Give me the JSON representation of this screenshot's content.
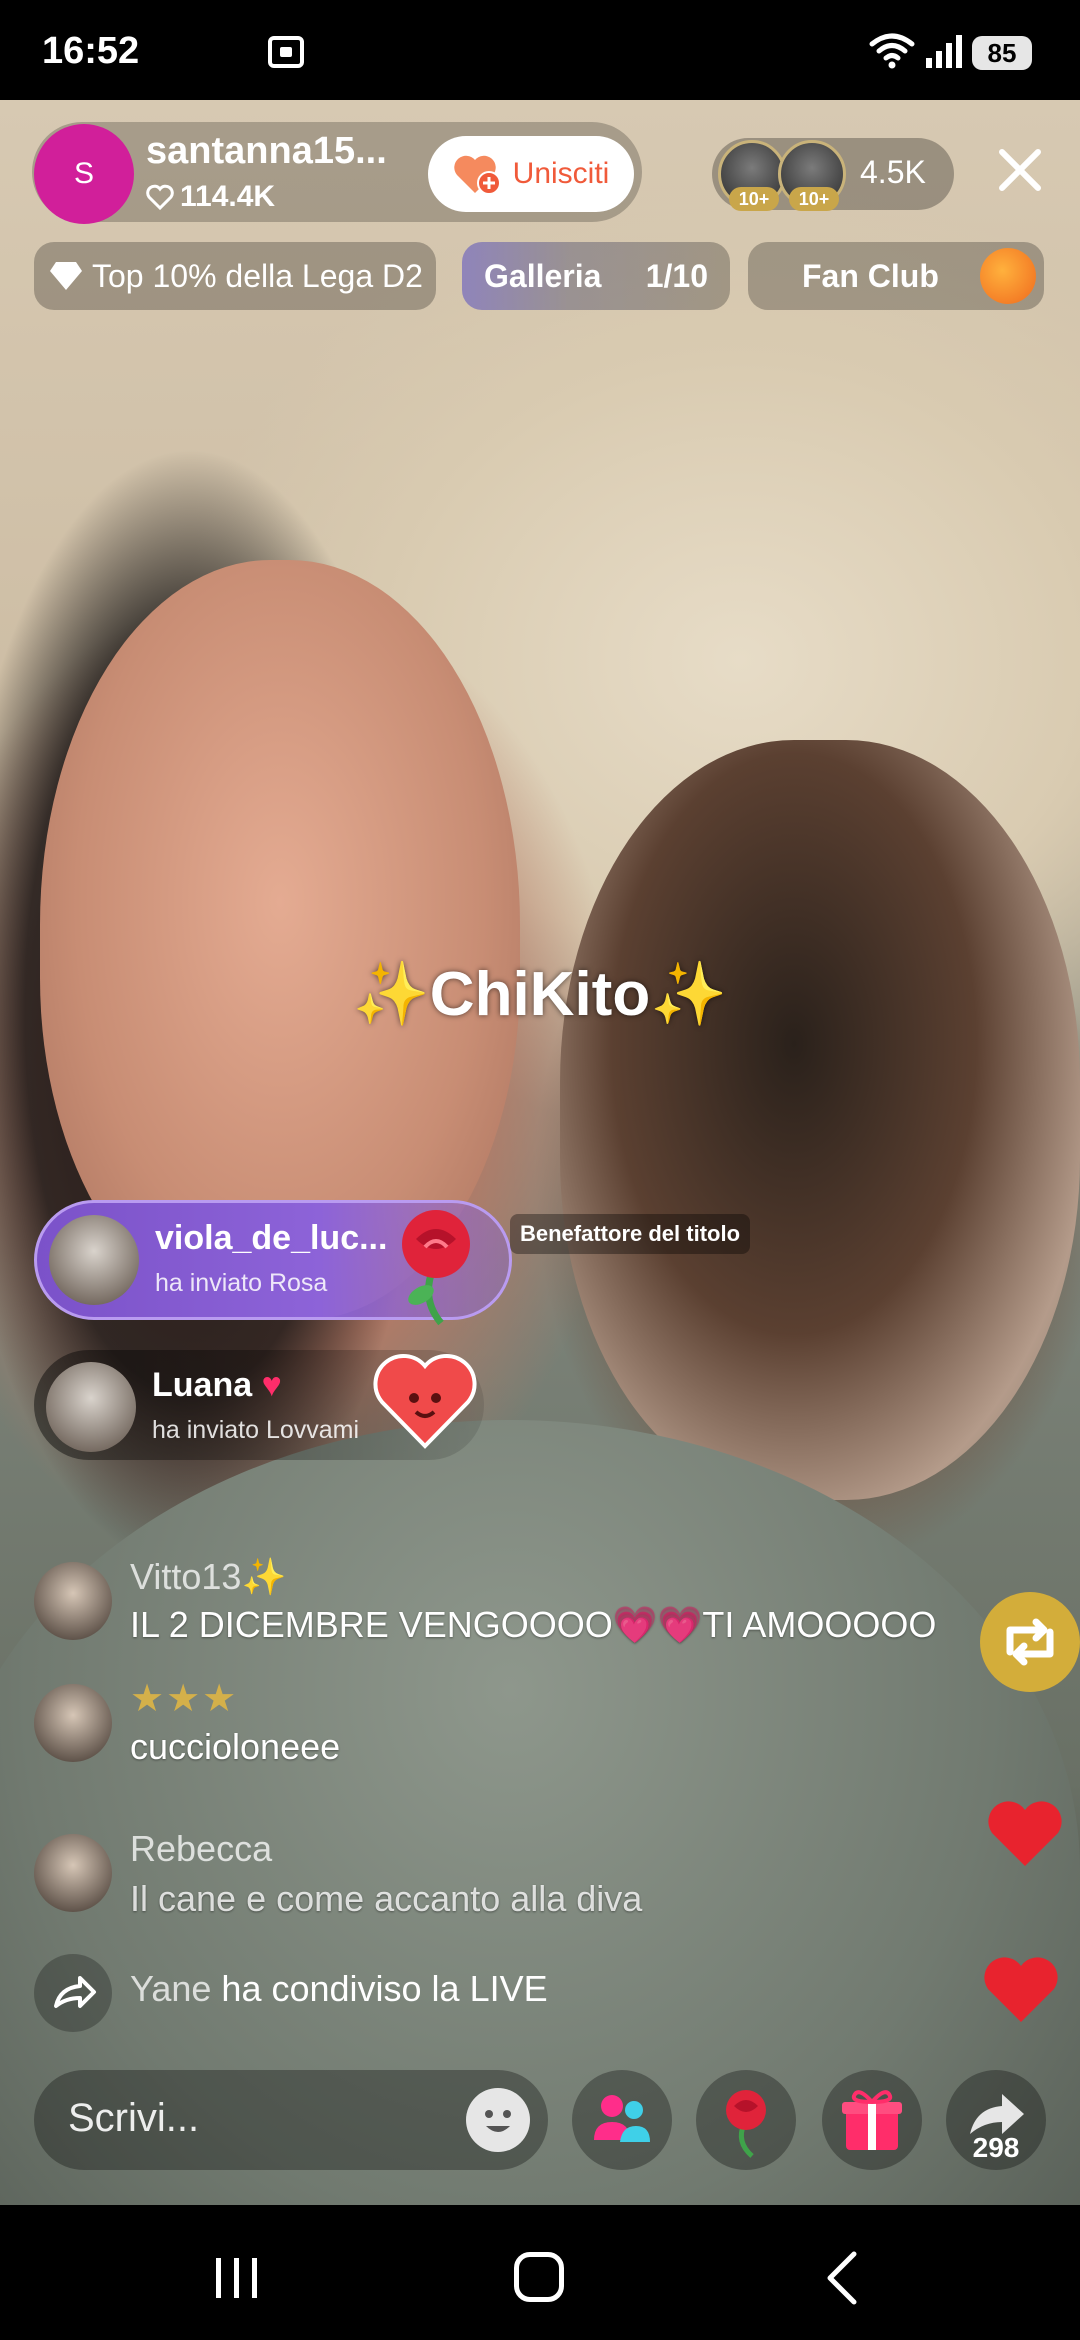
{
  "status_bar": {
    "time": "16:52",
    "battery": "85"
  },
  "host": {
    "avatar_letter": "S",
    "name": "santanna15...",
    "likes": "114.4K",
    "join_label": "Unisciti"
  },
  "viewers": {
    "badges": [
      "10+",
      "10+"
    ],
    "count": "4.5K"
  },
  "chips": {
    "league": "Top 10% della Lega D2",
    "gallery_label": "Galleria",
    "gallery_count": "1/10",
    "fan_club": "Fan Club"
  },
  "overlay_title": "ChiKito",
  "gifts": [
    {
      "user": "viola_de_luc...",
      "action": "ha inviato Rosa",
      "gift_icon": "rose-icon"
    },
    {
      "user": "Luana",
      "action": "ha inviato Lovvami",
      "gift_icon": "heart-gift-icon"
    }
  ],
  "benefactor_label": "Benefattore del titolo",
  "comments": [
    {
      "user": "Vitto13",
      "text": "IL 2 DICEMBRE VENGOOOO💗💗TI AMOOOOO"
    },
    {
      "user": "",
      "text": "cuccioloneee"
    },
    {
      "user": "Rebecca",
      "text": "Il cane e come accanto alla diva"
    }
  ],
  "share_notice": {
    "user": "Yane",
    "text": "ha condiviso la LIVE"
  },
  "bottom": {
    "placeholder": "Scrivi...",
    "share_count": "298"
  },
  "colors": {
    "host_avatar": "#d11f9a",
    "join_text": "#f05a3a",
    "gift_banner": "#8d63d8",
    "repost_button": "#d3ad3a",
    "like_heart": "#e8232e"
  }
}
